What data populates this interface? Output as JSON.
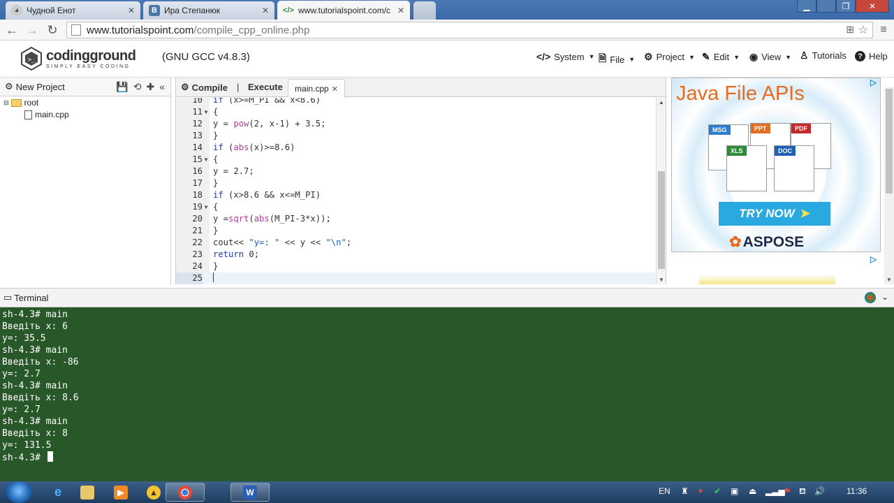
{
  "browser": {
    "tabs": [
      {
        "title": "Чудной Енот",
        "favicon": "raccoon-icon"
      },
      {
        "title": "Ира Степанюк",
        "favicon": "vk-icon"
      },
      {
        "title": "www.tutorialspoint.com/c",
        "favicon": "code-icon"
      }
    ],
    "url_host": "www.tutorialspoint.com",
    "url_path": "/compile_cpp_online.php"
  },
  "site": {
    "logo_name": "codingground",
    "logo_tagline": "SIMPLY EASY CODING",
    "compiler": "(GNU GCC v4.8.3)",
    "menu": [
      {
        "label": "System",
        "icon": "code-icon"
      },
      {
        "label": "File",
        "icon": "file-icon"
      },
      {
        "label": "Project",
        "icon": "gear-icon"
      },
      {
        "label": "Edit",
        "icon": "edit-icon"
      },
      {
        "label": "View",
        "icon": "eye-icon"
      },
      {
        "label": "Tutorials",
        "icon": "tutorials-icon"
      },
      {
        "label": "Help",
        "icon": "help-icon"
      }
    ]
  },
  "project": {
    "title": "New Project",
    "tree": {
      "root": "root",
      "file": "main.cpp"
    }
  },
  "editor": {
    "compile": "Compile",
    "separator": "|",
    "execute": "Execute",
    "tab": "main.cpp",
    "lines": [
      {
        "n": "10",
        "fold": false,
        "html": "<span class=\"kw\">if</span> (x>=M_PI && x<8.6)"
      },
      {
        "n": "11",
        "fold": true,
        "html": "{"
      },
      {
        "n": "12",
        "fold": false,
        "html": "y = <span class=\"fn\">pow</span>(2, x-1) + 3.5;"
      },
      {
        "n": "13",
        "fold": false,
        "html": "}"
      },
      {
        "n": "14",
        "fold": false,
        "html": "<span class=\"kw\">if</span> (<span class=\"fn\">abs</span>(x)>=8.6)"
      },
      {
        "n": "15",
        "fold": true,
        "html": "{"
      },
      {
        "n": "16",
        "fold": false,
        "html": "y = 2.7;"
      },
      {
        "n": "17",
        "fold": false,
        "html": "}"
      },
      {
        "n": "18",
        "fold": false,
        "html": "<span class=\"kw\">if</span> (x>8.6 && x<=M_PI)"
      },
      {
        "n": "19",
        "fold": true,
        "html": "{"
      },
      {
        "n": "20",
        "fold": false,
        "html": "y =<span class=\"fn\">sqrt</span>(<span class=\"fn\">abs</span>(M_PI-3*x));"
      },
      {
        "n": "21",
        "fold": false,
        "html": "}"
      },
      {
        "n": "22",
        "fold": false,
        "html": "cout<< <span class=\"str\">\"y=: \"</span> << y << <span class=\"str\">\"\\n\"</span>;"
      },
      {
        "n": "23",
        "fold": false,
        "html": "<span class=\"kw\">return</span> 0;"
      },
      {
        "n": "24",
        "fold": false,
        "html": "}"
      },
      {
        "n": "25",
        "fold": false,
        "html": ""
      }
    ]
  },
  "ad": {
    "title": "Java File APIs",
    "docs": [
      "MSG",
      "PPT",
      "PDF",
      "XLS",
      "DOC"
    ],
    "button": "TRY NOW",
    "brand": "ASPOSE",
    "choices_icon": "adchoices-icon"
  },
  "terminal": {
    "title": "Terminal",
    "lines": [
      "sh-4.3# main",
      "Введіть x: 6",
      "y=: 35.5",
      "sh-4.3# main",
      "Введіть x: -86",
      "y=: 2.7",
      "sh-4.3# main",
      "Введіть x: 8.6",
      "y=: 2.7",
      "sh-4.3# main",
      "Введіть x: 8",
      "y=: 131.5",
      "sh-4.3# "
    ]
  },
  "taskbar": {
    "lang": "EN",
    "clock": "11:36"
  }
}
